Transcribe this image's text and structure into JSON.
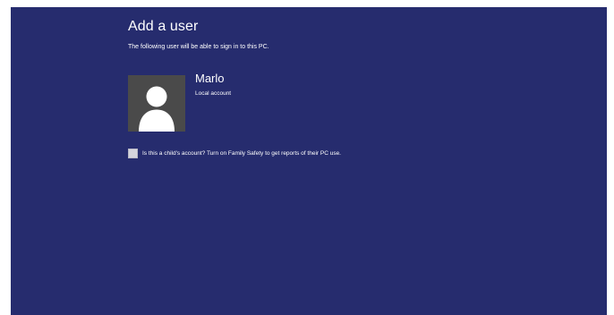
{
  "page": {
    "title": "Add a user",
    "subtitle": "The following user will be able to sign in to this PC."
  },
  "user": {
    "name": "Marlo",
    "account_type": "Local account",
    "avatar_icon": "user-silhouette-icon"
  },
  "family_safety": {
    "checkbox_checked": false,
    "label": "Is this a child's account? Turn on Family Safety to get reports of their PC use."
  },
  "colors": {
    "background": "#262c6e",
    "text": "#ffffff",
    "avatar_background": "#4a4a4a"
  }
}
